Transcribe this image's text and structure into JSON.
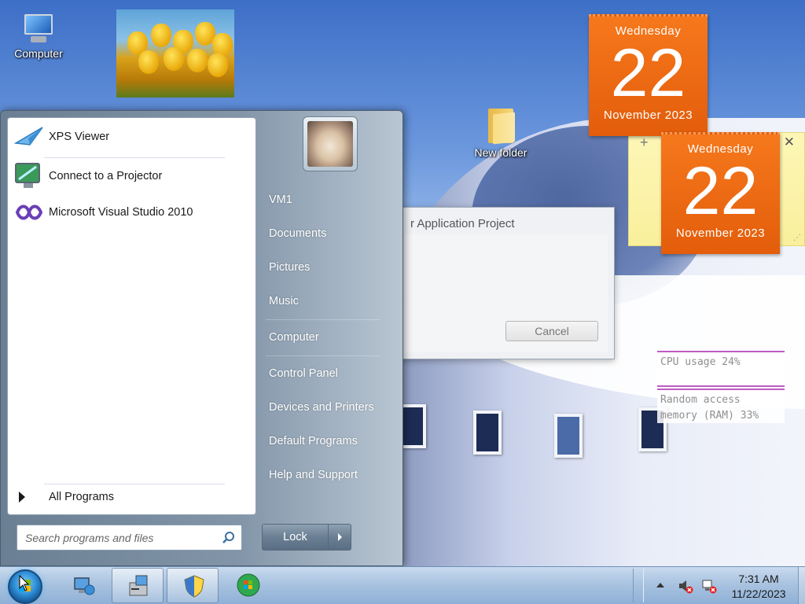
{
  "desktop": {
    "icons": [
      {
        "label": "Computer"
      },
      {
        "label": "New folder"
      }
    ]
  },
  "calendar_gadgets": [
    {
      "day_name": "Wednesday",
      "day_number": "22",
      "month_year": "November 2023"
    },
    {
      "day_name": "Wednesday",
      "day_number": "22",
      "month_year": "November 2023"
    }
  ],
  "sticky_note": {
    "add_label": "+",
    "close_label": "✕"
  },
  "cpu_meter": {
    "cpu_label": "CPU usage 24%",
    "ram_label": "Random access memory (RAM) 33%"
  },
  "dialog": {
    "title": "r Application Project",
    "cancel_label": "Cancel"
  },
  "start_menu": {
    "pinned": [
      {
        "label": "XPS Viewer",
        "icon": "xps-viewer-icon"
      },
      {
        "label": "Connect to a Projector",
        "icon": "projector-icon"
      },
      {
        "label": "Microsoft Visual Studio 2010",
        "icon": "visual-studio-icon"
      }
    ],
    "all_programs_label": "All Programs",
    "search_placeholder": "Search programs and files",
    "right_items": [
      {
        "label": "VM1"
      },
      {
        "label": "Documents"
      },
      {
        "label": "Pictures"
      },
      {
        "label": "Music"
      },
      {
        "label": "Computer"
      },
      {
        "label": "Control Panel"
      },
      {
        "label": "Devices and Printers"
      },
      {
        "label": "Default Programs"
      },
      {
        "label": "Help and Support"
      }
    ],
    "lock_label": "Lock"
  },
  "taskbar": {
    "clock_time": "7:31 AM",
    "clock_date": "11/22/2023"
  },
  "colors": {
    "calendar_orange": "#e35d0b",
    "meter_accent": "#c05cc4",
    "taskbar": "#a9c3e0"
  }
}
